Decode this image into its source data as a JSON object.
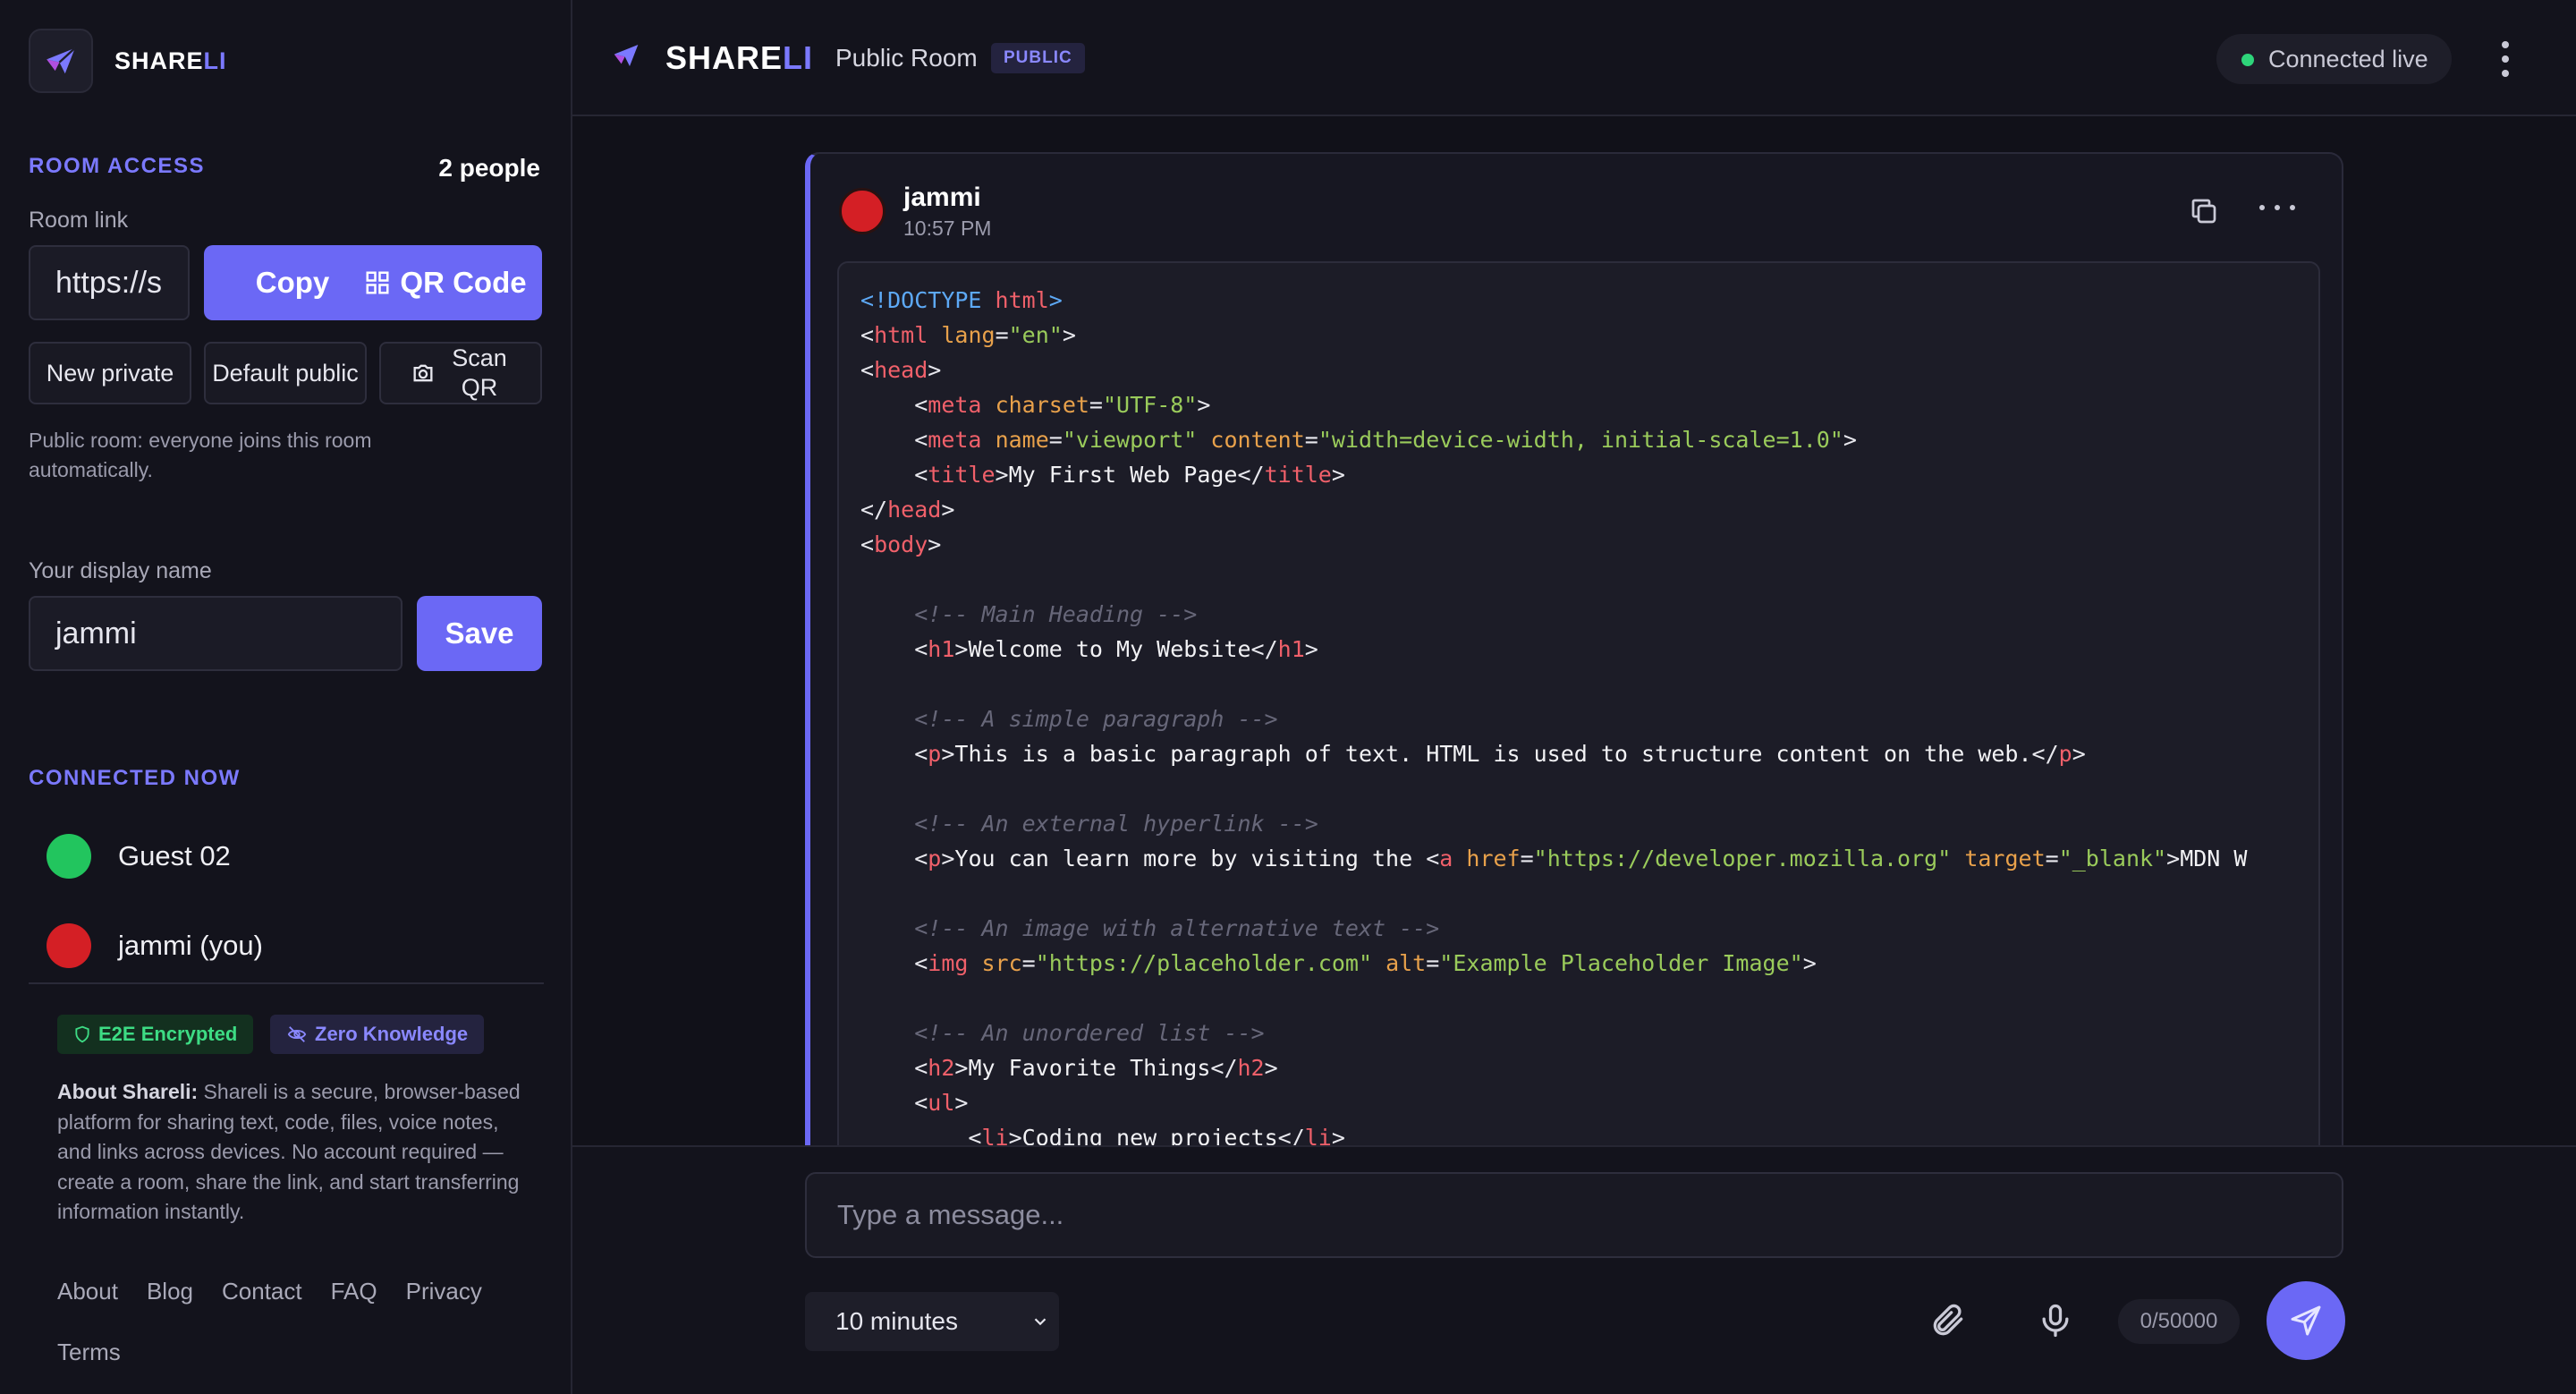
{
  "brand": {
    "name_main": "SHARE",
    "name_accent": "LI",
    "logo_icon": "paper-plane-icon"
  },
  "sidebar": {
    "room_access_label": "ROOM ACCESS",
    "people_count": "2 people",
    "room_link_label": "Room link",
    "room_link_value": "https://s",
    "copy_label": "Copy",
    "qr_code_label": "QR Code",
    "new_private_label": "New private",
    "default_public_label": "Default public",
    "scan_qr_label": "Scan QR",
    "public_note": "Public room: everyone joins this room automatically.",
    "display_name_label": "Your display name",
    "display_name_value": "jammi",
    "save_label": "Save",
    "connected_label": "CONNECTED NOW",
    "users": [
      {
        "name": "Guest 02",
        "color": "#22c55e"
      },
      {
        "name": "jammi (you)",
        "color": "#d41f25"
      }
    ],
    "badge_e2e": "E2E Encrypted",
    "badge_zk": "Zero Knowledge",
    "about_title": "About Shareli:",
    "about_text": " Shareli is a secure, browser-based platform for sharing text, code, files, voice notes, and links across devices. No account required — create a room, share the link, and start transferring information instantly.",
    "footer_links": [
      "About",
      "Blog",
      "Contact",
      "FAQ",
      "Privacy",
      "Terms"
    ]
  },
  "header": {
    "brand_main": "SHARE",
    "brand_accent": "LI",
    "room_name": "Public Room",
    "room_badge": "PUBLIC",
    "status": "Connected live",
    "status_color": "#2ed57a"
  },
  "message": {
    "author": "jammi",
    "time": "10:57 PM",
    "avatar_color": "#d41f25",
    "code_lines": [
      "<!DOCTYPE html>",
      "<html lang=\"en\">",
      "<head>",
      "    <meta charset=\"UTF-8\">",
      "    <meta name=\"viewport\" content=\"width=device-width, initial-scale=1.0\">",
      "    <title>My First Web Page</title>",
      "</head>",
      "<body>",
      "",
      "    <!-- Main Heading -->",
      "    <h1>Welcome to My Website</h1>",
      "",
      "    <!-- A simple paragraph -->",
      "    <p>This is a basic paragraph of text. HTML is used to structure content on the web.</p>",
      "",
      "    <!-- An external hyperlink -->",
      "    <p>You can learn more by visiting the <a href=\"https://developer.mozilla.org\" target=\"_blank\">MDN W",
      "",
      "    <!-- An image with alternative text -->",
      "    <img src=\"https://placeholder.com\" alt=\"Example Placeholder Image\">",
      "",
      "    <!-- An unordered list -->",
      "    <h2>My Favorite Things</h2>",
      "    <ul>",
      "        <li>Coding new projects</li>"
    ]
  },
  "composer": {
    "placeholder": "Type a message...",
    "expiry": "10 minutes",
    "char_count": "0/50000"
  },
  "colors": {
    "accent": "#6b68f5",
    "accent_text": "#7b79ff",
    "bg": "#0f0f17",
    "panel": "#13131c"
  }
}
